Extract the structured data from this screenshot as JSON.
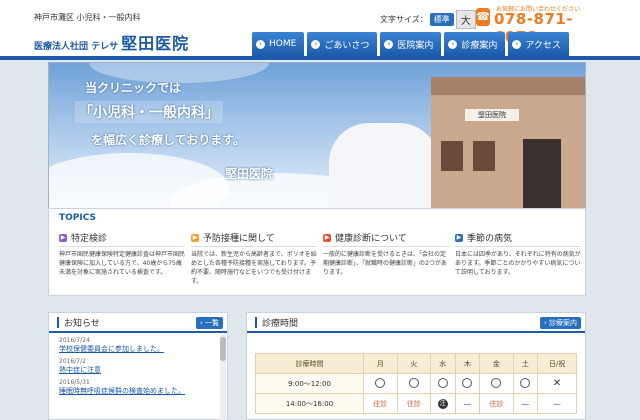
{
  "header": {
    "tagline": "神戸市灘区 小児科・一般内科",
    "logo_prefix": "医療法人社団 テレサ",
    "logo_name": "堅田医院",
    "font_size_label": "文字サイズ：",
    "font_std": "標準",
    "font_big": "大",
    "phone_note": "お気軽にお問い合わせください",
    "phone": "078-871-6078"
  },
  "nav": [
    {
      "label": "HOME"
    },
    {
      "label": "ごあいさつ"
    },
    {
      "label": "医院案内"
    },
    {
      "label": "診療案内"
    },
    {
      "label": "アクセス"
    }
  ],
  "hero": {
    "line1": "当クリニックでは",
    "line2": "「小児科・一般内科」",
    "line3": "を幅広く診療しております。",
    "line4": "堅田医院",
    "sign": "堅田医院"
  },
  "topics": {
    "title": "TOPICS",
    "cards": [
      {
        "title": "特定検診",
        "color": "#8a5cc9",
        "body": "神戸市国民健康保険特定健康診査は神戸市国民健康保険に加入している方で、40歳から75歳未満を対象に実施されている検査です。"
      },
      {
        "title": "予防接種に関して",
        "color": "#f0a23a",
        "body": "当院では、新生児から高齢者まで、ポリオを始めとした各種予防接種を実施しております。予約不要、随時施行などをいつでも受け付けます。"
      },
      {
        "title": "健康診断について",
        "color": "#e0572f",
        "body": "一般的に健康診断を受けるときは、「会社の定期健康診断」、「就職時の健康診断」の2つがあります。"
      },
      {
        "title": "季節の病気",
        "color": "#2a6fbf",
        "body": "日本には四季があり、それぞれに特有の病気があります。季節ごとのかかりやすい病気について説明しております。"
      }
    ]
  },
  "news": {
    "title": "お知らせ",
    "button": "一覧",
    "items": [
      {
        "date": "2016/7/24",
        "text": "学校保健委員会に参加しました。"
      },
      {
        "date": "2016/7/2",
        "text": "熱中症に注意"
      },
      {
        "date": "2016/5/31",
        "text": "睡眠時無呼吸症候群の検査始めました。"
      }
    ]
  },
  "hours": {
    "title": "診療時間",
    "button": "診療案内",
    "head": [
      "診療時間",
      "月",
      "火",
      "水",
      "木",
      "金",
      "土",
      "日/祝"
    ],
    "rows": [
      {
        "time": "9:00～12:00",
        "cells": [
          "o",
          "o",
          "o",
          "o",
          "o",
          "o",
          "x"
        ]
      },
      {
        "time": "14:00～16:00",
        "cells": [
          "往診",
          "往診",
          "注",
          "―",
          "往診",
          "―",
          "―"
        ]
      }
    ],
    "note_mark": "注"
  }
}
